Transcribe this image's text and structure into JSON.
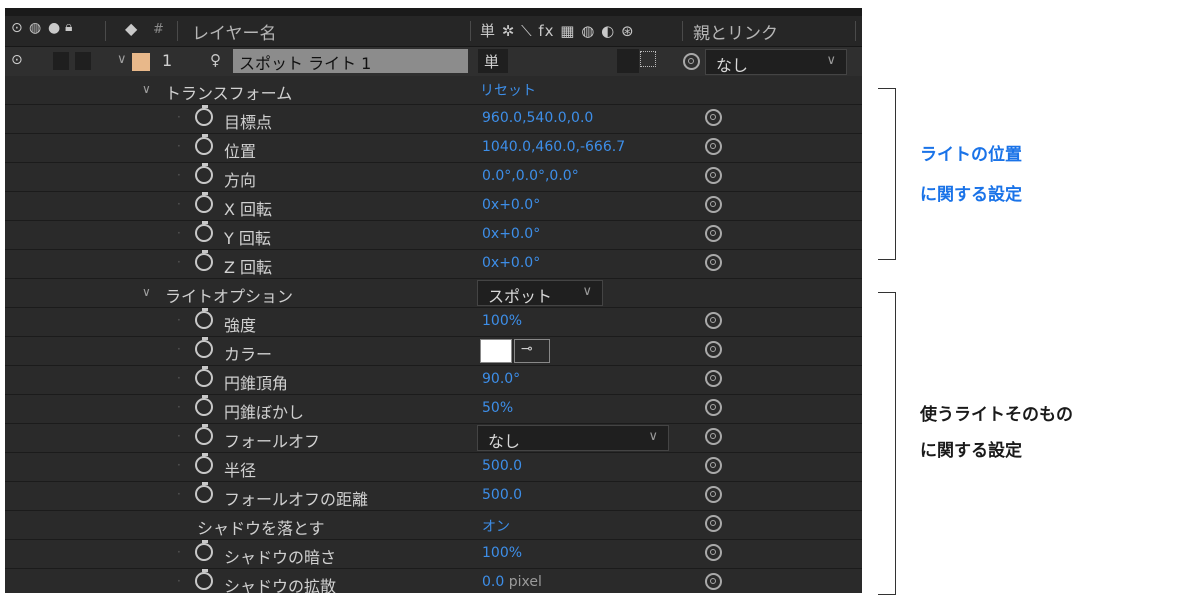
{
  "header": {
    "layer_name_col": "レイヤー名",
    "parent_link_col": "親とリンク",
    "switch_icons": "単 ✲ ⟍ fx ▦ ◍ ◐ ⊛"
  },
  "layer": {
    "number": "1",
    "name": "スポット ライト 1",
    "switch": "単",
    "parent_value": "なし",
    "label_color": "#e8b88a"
  },
  "groups": {
    "transform": {
      "label": "トランスフォーム",
      "reset": "リセット"
    },
    "light_options": {
      "label": "ライトオプション",
      "light_type": "スポット"
    }
  },
  "rows": [
    {
      "label": "目標点",
      "value": "960.0,540.0,0.0"
    },
    {
      "label": "位置",
      "value": "1040.0,460.0,-666.7"
    },
    {
      "label": "方向",
      "value": "0.0°,0.0°,0.0°"
    },
    {
      "label": "X 回転",
      "value": "0x+0.0°"
    },
    {
      "label": "Y 回転",
      "value": "0x+0.0°"
    },
    {
      "label": "Z 回転",
      "value": "0x+0.0°"
    },
    {
      "label": "強度",
      "value": "100%"
    },
    {
      "label": "カラー",
      "value": ""
    },
    {
      "label": "円錐頂角",
      "value": "90.0°"
    },
    {
      "label": "円錐ぼかし",
      "value": "50%"
    },
    {
      "label": "フォールオフ",
      "value": "なし"
    },
    {
      "label": "半径",
      "value": "500.0"
    },
    {
      "label": "フォールオフの距離",
      "value": "500.0"
    },
    {
      "label": "シャドウを落とす",
      "value": "オン"
    },
    {
      "label": "シャドウの暗さ",
      "value": "100%"
    },
    {
      "label": "シャドウの拡散",
      "value": "0.0",
      "unit": "pixel"
    }
  ],
  "colors": {
    "accent": "#3d8ee8",
    "note": "#1a73e8",
    "color_swatch": "#ffffff"
  },
  "annotations": {
    "transform_note_line1": "ライトの位置",
    "transform_note_line2": "に関する設定",
    "options_note_line1": "使うライトそのもの",
    "options_note_line2": "に関する設定"
  }
}
